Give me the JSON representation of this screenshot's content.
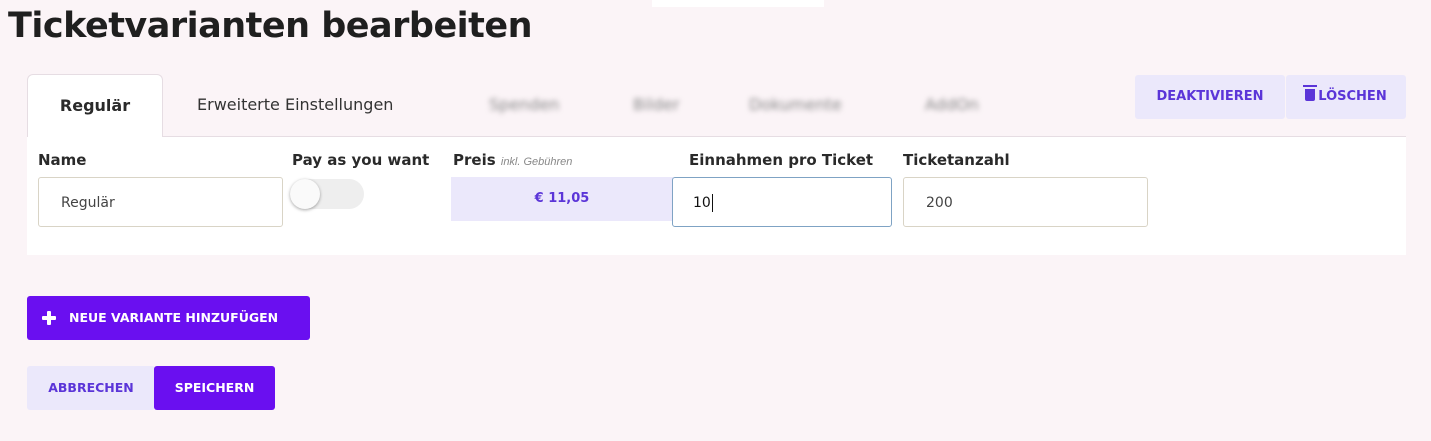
{
  "page_title": "Ticketvarianten bearbeiten",
  "tabs": [
    {
      "label": "Regulär",
      "active": true
    },
    {
      "label": "Erweiterte Einstellungen"
    },
    {
      "label": "Spenden"
    },
    {
      "label": "Bilder"
    },
    {
      "label": "Dokumente"
    },
    {
      "label": "AddOn"
    }
  ],
  "actions": {
    "deactivate_label": "DEAKTIVIEREN",
    "delete_label": "LÖSCHEN"
  },
  "form": {
    "name_label": "Name",
    "name_value": "Regulär",
    "pay_as_you_want_label": "Pay as you want",
    "pay_as_you_want_enabled": false,
    "price_label": "Preis",
    "price_note": "inkl. Gebühren",
    "price_value": "€  11,05",
    "revenue_label": "Einnahmen pro Ticket",
    "revenue_value": "10",
    "count_label": "Ticketanzahl",
    "count_value": "200"
  },
  "buttons": {
    "add_variant": "NEUE VARIANTE HINZUFÜGEN",
    "cancel": "ABBRECHEN",
    "save": "SPEICHERN"
  },
  "colors": {
    "accent": "#6a0ff0",
    "accent_light": "#ebe8fb",
    "accent_text": "#5b35d8",
    "background": "#fbf4f7"
  }
}
